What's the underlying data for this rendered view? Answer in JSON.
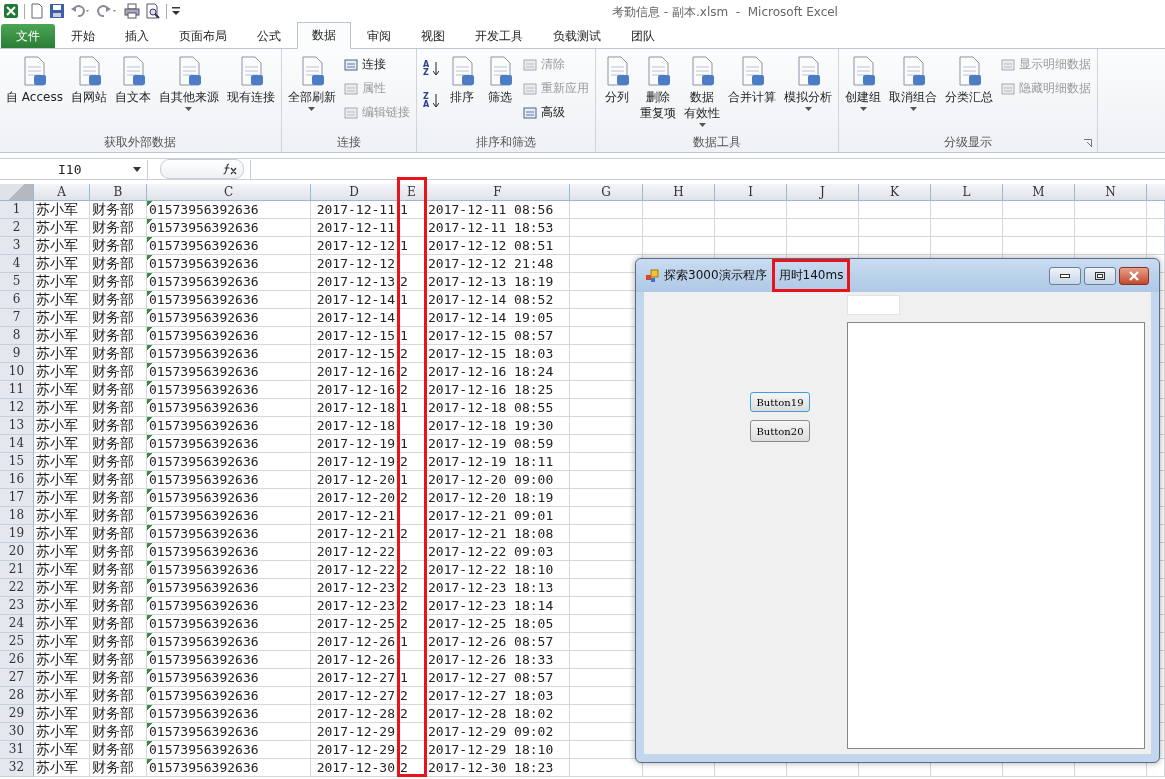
{
  "window": {
    "title": "考勤信息 - 副本.xlsm  -  Microsoft Excel"
  },
  "tabs": [
    {
      "label": "文件",
      "kind": "file",
      "selected": false
    },
    {
      "label": "开始",
      "kind": "tab",
      "selected": false
    },
    {
      "label": "插入",
      "kind": "tab",
      "selected": false
    },
    {
      "label": "页面布局",
      "kind": "tab",
      "selected": false
    },
    {
      "label": "公式",
      "kind": "tab",
      "selected": false
    },
    {
      "label": "数据",
      "kind": "tab",
      "selected": true
    },
    {
      "label": "审阅",
      "kind": "tab",
      "selected": false
    },
    {
      "label": "视图",
      "kind": "tab",
      "selected": false
    },
    {
      "label": "开发工具",
      "kind": "tab",
      "selected": false
    },
    {
      "label": "负载测试",
      "kind": "tab",
      "selected": false
    },
    {
      "label": "团队",
      "kind": "tab",
      "selected": false
    }
  ],
  "ribbon": [
    {
      "label": "获取外部数据",
      "launcher": false,
      "items": [
        {
          "kind": "large",
          "label": "自 Access",
          "dropdown": false,
          "disabled": false
        },
        {
          "kind": "large",
          "label": "自网站",
          "dropdown": false,
          "disabled": false
        },
        {
          "kind": "large",
          "label": "自文本",
          "dropdown": false,
          "disabled": false
        },
        {
          "kind": "large",
          "label": "自其他来源",
          "dropdown": true,
          "disabled": false
        },
        {
          "kind": "large",
          "label": "现有连接",
          "dropdown": false,
          "disabled": false
        }
      ]
    },
    {
      "label": "连接",
      "launcher": false,
      "items": [
        {
          "kind": "large",
          "label": "全部刷新",
          "dropdown": true,
          "disabled": false
        },
        {
          "kind": "stack",
          "items": [
            {
              "label": "连接",
              "disabled": false
            },
            {
              "label": "属性",
              "disabled": true
            },
            {
              "label": "编辑链接",
              "disabled": true
            }
          ]
        }
      ]
    },
    {
      "label": "排序和筛选",
      "launcher": false,
      "items": [
        {
          "kind": "sort",
          "items": [
            {
              "top": "A",
              "bottom": "Z"
            },
            {
              "top": "Z",
              "bottom": "A"
            }
          ]
        },
        {
          "kind": "large",
          "label": "排序",
          "dropdown": false,
          "disabled": false
        },
        {
          "kind": "large",
          "label": "筛选",
          "dropdown": false,
          "disabled": false
        },
        {
          "kind": "stack",
          "items": [
            {
              "label": "清除",
              "disabled": true
            },
            {
              "label": "重新应用",
              "disabled": true
            },
            {
              "label": "高级",
              "disabled": false
            }
          ]
        }
      ]
    },
    {
      "label": "数据工具",
      "launcher": false,
      "items": [
        {
          "kind": "large",
          "label": "分列",
          "dropdown": false,
          "disabled": false
        },
        {
          "kind": "large",
          "label": "删除",
          "label_2": "重复项",
          "dropdown": false,
          "disabled": false
        },
        {
          "kind": "large",
          "label": "数据",
          "label_2": "有效性",
          "dropdown": true,
          "disabled": false
        },
        {
          "kind": "large",
          "label": "合并计算",
          "dropdown": false,
          "disabled": false
        },
        {
          "kind": "large",
          "label": "模拟分析",
          "dropdown": true,
          "disabled": false
        }
      ]
    },
    {
      "label": "分级显示",
      "launcher": true,
      "items": [
        {
          "kind": "large",
          "label": "创建组",
          "dropdown": true,
          "disabled": false
        },
        {
          "kind": "large",
          "label": "取消组合",
          "dropdown": true,
          "disabled": false
        },
        {
          "kind": "large",
          "label": "分类汇总",
          "dropdown": false,
          "disabled": false
        },
        {
          "kind": "stack",
          "items": [
            {
              "label": "显示明细数据",
              "disabled": true
            },
            {
              "label": "隐藏明细数据",
              "disabled": true
            }
          ]
        }
      ]
    }
  ],
  "name_box": {
    "value": "I10"
  },
  "columns": [
    {
      "label": "A",
      "highlighted": false
    },
    {
      "label": "B",
      "highlighted": false
    },
    {
      "label": "C",
      "highlighted": false
    },
    {
      "label": "D",
      "highlighted": false
    },
    {
      "label": "E",
      "highlighted": true
    },
    {
      "label": "F",
      "highlighted": false
    },
    {
      "label": "G",
      "highlighted": false
    },
    {
      "label": "H",
      "highlighted": false
    },
    {
      "label": "I",
      "highlighted": false
    },
    {
      "label": "J",
      "highlighted": false
    },
    {
      "label": "K",
      "highlighted": false
    },
    {
      "label": "L",
      "highlighted": false
    },
    {
      "label": "M",
      "highlighted": false
    },
    {
      "label": "N",
      "highlighted": false
    }
  ],
  "rows": [
    {
      "row": "1",
      "a": "苏小军",
      "b": "财务部",
      "c": "01573956392636",
      "d": "2017-12-11",
      "e": "1",
      "f": "2017-12-11 08:56"
    },
    {
      "row": "2",
      "a": "苏小军",
      "b": "财务部",
      "c": "01573956392636",
      "d": "2017-12-11",
      "f": "2017-12-11 18:53"
    },
    {
      "row": "3",
      "a": "苏小军",
      "b": "财务部",
      "c": "01573956392636",
      "d": "2017-12-12",
      "e": "1",
      "f": "2017-12-12 08:51"
    },
    {
      "row": "4",
      "a": "苏小军",
      "b": "财务部",
      "c": "01573956392636",
      "d": "2017-12-12",
      "f": "2017-12-12 21:48"
    },
    {
      "row": "5",
      "a": "苏小军",
      "b": "财务部",
      "c": "01573956392636",
      "d": "2017-12-13",
      "e": "2",
      "f": "2017-12-13 18:19"
    },
    {
      "row": "6",
      "a": "苏小军",
      "b": "财务部",
      "c": "01573956392636",
      "d": "2017-12-14",
      "e": "1",
      "f": "2017-12-14 08:52"
    },
    {
      "row": "7",
      "a": "苏小军",
      "b": "财务部",
      "c": "01573956392636",
      "d": "2017-12-14",
      "f": "2017-12-14 19:05"
    },
    {
      "row": "8",
      "a": "苏小军",
      "b": "财务部",
      "c": "01573956392636",
      "d": "2017-12-15",
      "e": "1",
      "f": "2017-12-15 08:57"
    },
    {
      "row": "9",
      "a": "苏小军",
      "b": "财务部",
      "c": "01573956392636",
      "d": "2017-12-15",
      "e": "2",
      "f": "2017-12-15 18:03"
    },
    {
      "row": "10",
      "a": "苏小军",
      "b": "财务部",
      "c": "01573956392636",
      "d": "2017-12-16",
      "e": "2",
      "f": "2017-12-16 18:24"
    },
    {
      "row": "11",
      "a": "苏小军",
      "b": "财务部",
      "c": "01573956392636",
      "d": "2017-12-16",
      "e": "2",
      "f": "2017-12-16 18:25"
    },
    {
      "row": "12",
      "a": "苏小军",
      "b": "财务部",
      "c": "01573956392636",
      "d": "2017-12-18",
      "e": "1",
      "f": "2017-12-18 08:55"
    },
    {
      "row": "13",
      "a": "苏小军",
      "b": "财务部",
      "c": "01573956392636",
      "d": "2017-12-18",
      "f": "2017-12-18 19:30"
    },
    {
      "row": "14",
      "a": "苏小军",
      "b": "财务部",
      "c": "01573956392636",
      "d": "2017-12-19",
      "e": "1",
      "f": "2017-12-19 08:59"
    },
    {
      "row": "15",
      "a": "苏小军",
      "b": "财务部",
      "c": "01573956392636",
      "d": "2017-12-19",
      "e": "2",
      "f": "2017-12-19 18:11"
    },
    {
      "row": "16",
      "a": "苏小军",
      "b": "财务部",
      "c": "01573956392636",
      "d": "2017-12-20",
      "e": "1",
      "f": "2017-12-20 09:00"
    },
    {
      "row": "17",
      "a": "苏小军",
      "b": "财务部",
      "c": "01573956392636",
      "d": "2017-12-20",
      "e": "2",
      "f": "2017-12-20 18:19"
    },
    {
      "row": "18",
      "a": "苏小军",
      "b": "财务部",
      "c": "01573956392636",
      "d": "2017-12-21",
      "f": "2017-12-21 09:01"
    },
    {
      "row": "19",
      "a": "苏小军",
      "b": "财务部",
      "c": "01573956392636",
      "d": "2017-12-21",
      "e": "2",
      "f": "2017-12-21 18:08"
    },
    {
      "row": "20",
      "a": "苏小军",
      "b": "财务部",
      "c": "01573956392636",
      "d": "2017-12-22",
      "f": "2017-12-22 09:03"
    },
    {
      "row": "21",
      "a": "苏小军",
      "b": "财务部",
      "c": "01573956392636",
      "d": "2017-12-22",
      "e": "2",
      "f": "2017-12-22 18:10"
    },
    {
      "row": "22",
      "a": "苏小军",
      "b": "财务部",
      "c": "01573956392636",
      "d": "2017-12-23",
      "e": "2",
      "f": "2017-12-23 18:13"
    },
    {
      "row": "23",
      "a": "苏小军",
      "b": "财务部",
      "c": "01573956392636",
      "d": "2017-12-23",
      "e": "2",
      "f": "2017-12-23 18:14"
    },
    {
      "row": "24",
      "a": "苏小军",
      "b": "财务部",
      "c": "01573956392636",
      "d": "2017-12-25",
      "e": "2",
      "f": "2017-12-25 18:05"
    },
    {
      "row": "25",
      "a": "苏小军",
      "b": "财务部",
      "c": "01573956392636",
      "d": "2017-12-26",
      "e": "1",
      "f": "2017-12-26 08:57"
    },
    {
      "row": "26",
      "a": "苏小军",
      "b": "财务部",
      "c": "01573956392636",
      "d": "2017-12-26",
      "f": "2017-12-26 18:33"
    },
    {
      "row": "27",
      "a": "苏小军",
      "b": "财务部",
      "c": "01573956392636",
      "d": "2017-12-27",
      "e": "1",
      "f": "2017-12-27 08:57"
    },
    {
      "row": "28",
      "a": "苏小军",
      "b": "财务部",
      "c": "01573956392636",
      "d": "2017-12-27",
      "e": "2",
      "f": "2017-12-27 18:03"
    },
    {
      "row": "29",
      "a": "苏小军",
      "b": "财务部",
      "c": "01573956392636",
      "d": "2017-12-28",
      "e": "2",
      "f": "2017-12-28 18:02"
    },
    {
      "row": "30",
      "a": "苏小军",
      "b": "财务部",
      "c": "01573956392636",
      "d": "2017-12-29",
      "f": "2017-12-29 09:02"
    },
    {
      "row": "31",
      "a": "苏小军",
      "b": "财务部",
      "c": "01573956392636",
      "d": "2017-12-29",
      "e": "2",
      "f": "2017-12-29 18:10"
    },
    {
      "row": "32",
      "a": "苏小军",
      "b": "财务部",
      "c": "01573956392636",
      "d": "2017-12-30",
      "e": "2",
      "f": "2017-12-30 18:23"
    }
  ],
  "dialog": {
    "title": "探索3000演示程序",
    "timing": "用时140ms",
    "timing_highlighted": true,
    "buttons": [
      {
        "label": "Button19",
        "focused": true
      },
      {
        "label": "Button20",
        "focused": false
      }
    ]
  }
}
